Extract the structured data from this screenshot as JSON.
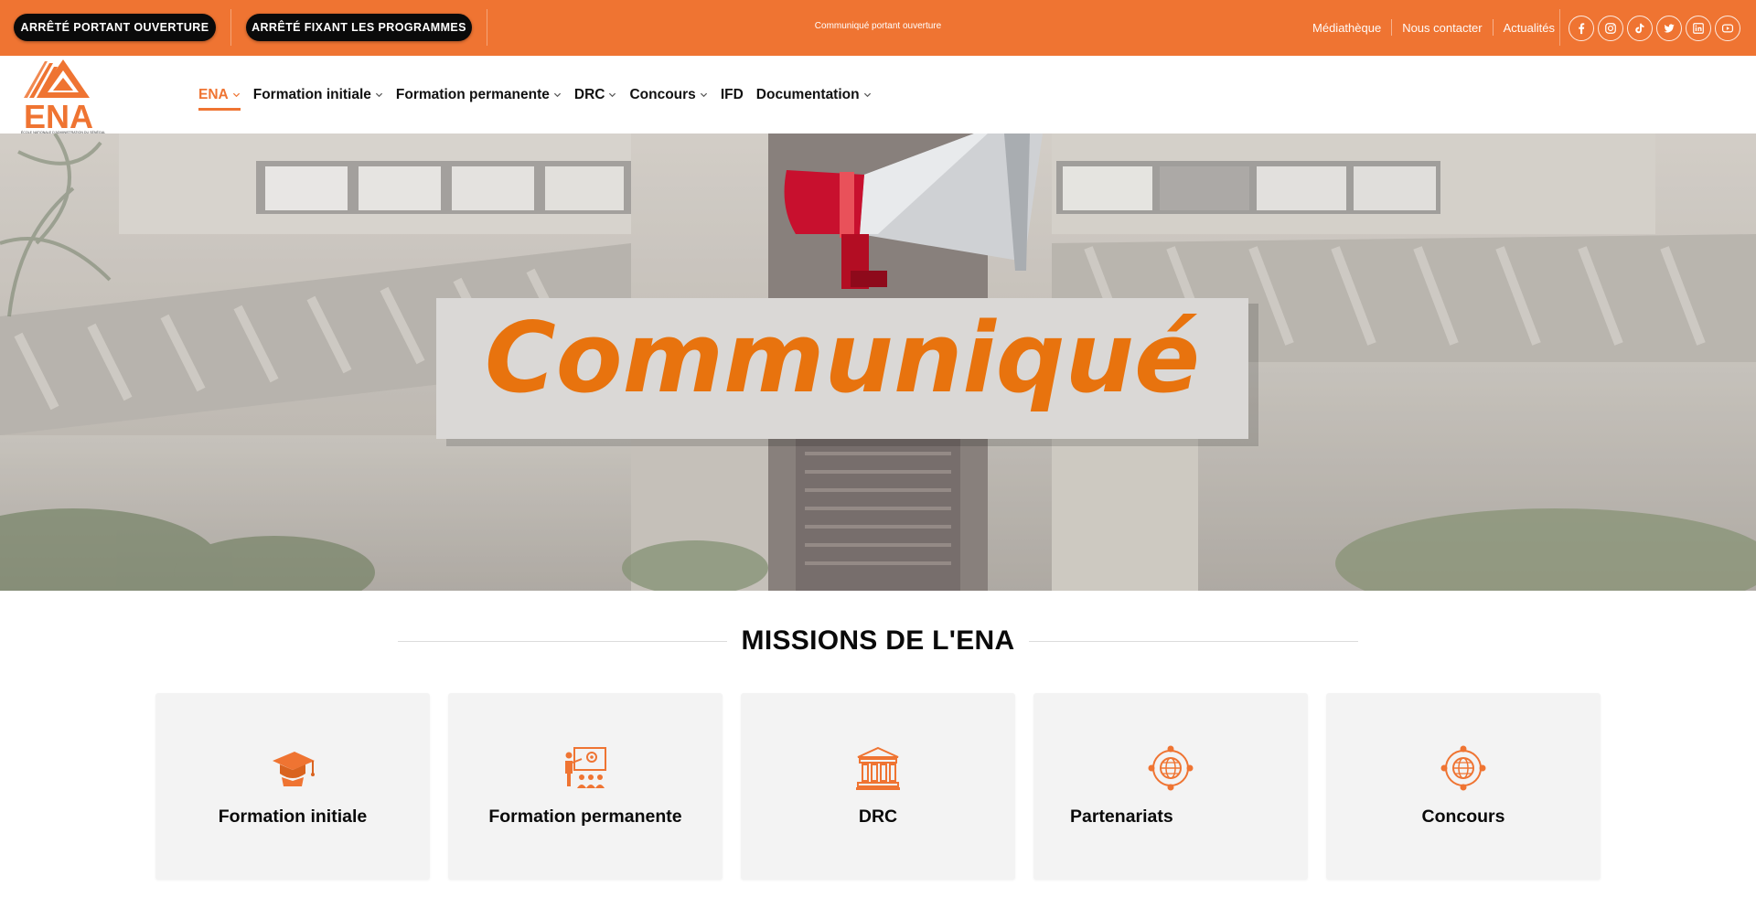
{
  "topbar": {
    "btn_ouverture": "ARRÊTÉ PORTANT OUVERTURE",
    "btn_programmes": "ARRÊTÉ FIXANT LES PROGRAMMES",
    "announcement": "Communiqué portant ouverture",
    "links": [
      "Médiathèque",
      "Nous contacter",
      "Actualités"
    ],
    "socials": [
      "facebook-icon",
      "instagram-icon",
      "tiktok-icon",
      "twitter-icon",
      "linkedin-icon",
      "youtube-icon"
    ]
  },
  "header": {
    "logo_text": "ENA",
    "logo_subtitle": "ÉCOLE NATIONALE D'ADMINISTRATION DU SÉNÉGAL",
    "nav": [
      {
        "label": "ENA",
        "dropdown": true,
        "active": true
      },
      {
        "label": "Formation initiale",
        "dropdown": true
      },
      {
        "label": "Formation permanente",
        "dropdown": true
      },
      {
        "label": "DRC",
        "dropdown": true
      },
      {
        "label": "Concours",
        "dropdown": true
      },
      {
        "label": "IFD",
        "dropdown": false
      },
      {
        "label": "Documentation",
        "dropdown": true
      }
    ]
  },
  "hero": {
    "banner_text": "Communiqué"
  },
  "missions": {
    "title": "MISSIONS DE L'ENA",
    "cards": [
      {
        "label": "Formation initiale",
        "icon": "graduation-cap-icon"
      },
      {
        "label": "Formation permanente",
        "icon": "training-presentation-icon"
      },
      {
        "label": "DRC",
        "icon": "institution-building-icon"
      },
      {
        "label": "Partenariats",
        "icon": "global-network-icon"
      },
      {
        "label": "Concours",
        "icon": "global-network-icon"
      }
    ]
  },
  "colors": {
    "brand_orange": "#ef7432",
    "pill_black": "#0a0a0a",
    "card_bg": "#f3f3f3"
  }
}
